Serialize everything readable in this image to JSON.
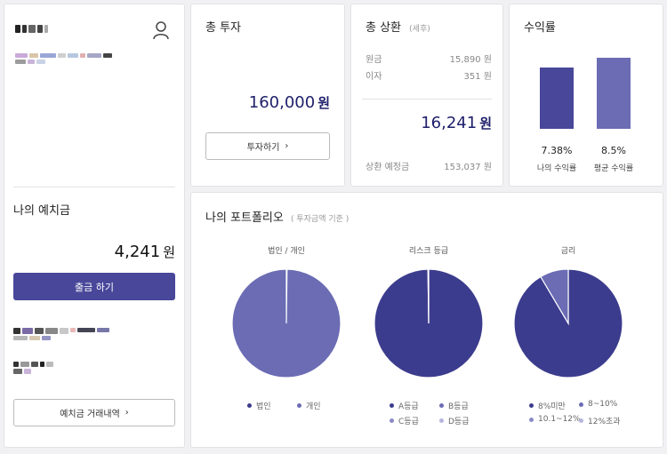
{
  "profile": {
    "user_icon": "user-icon"
  },
  "deposit": {
    "title": "나의 예치금",
    "amount": "4,241",
    "unit": "원",
    "withdraw_label": "출금 하기",
    "history_label": "예치금 거래내역"
  },
  "total_invest": {
    "title": "총 투자",
    "amount": "160,000",
    "unit": "원",
    "button_label": "투자하기"
  },
  "total_repay": {
    "title": "총 상환",
    "subtitle": "(세후)",
    "principal_label": "원금",
    "principal_value": "15,890 원",
    "interest_label": "이자",
    "interest_value": "351 원",
    "amount": "16,241",
    "unit": "원",
    "expected_label": "상환 예정금",
    "expected_value": "153,037 원"
  },
  "yield": {
    "title": "수익률",
    "colors": [
      "#48479a",
      "#6b6cb4"
    ]
  },
  "chart_data": [
    {
      "type": "bar",
      "categories": [
        "나의 수익률",
        "평균 수익률"
      ],
      "values": [
        7.38,
        8.5
      ],
      "value_labels": [
        "7.38%",
        "8.5%"
      ],
      "ylim": [
        0,
        8.5
      ]
    },
    {
      "type": "pie",
      "title": "법인 / 개인",
      "labels": [
        "법인",
        "개인"
      ],
      "values": [
        0.2,
        99.8
      ],
      "colors": [
        "#3c3c8e",
        "#6b6cb4"
      ]
    },
    {
      "type": "pie",
      "title": "리스크 등급",
      "labels": [
        "A등급",
        "B등급",
        "C등급",
        "D등급"
      ],
      "values": [
        99.8,
        0.2,
        0,
        0
      ],
      "colors": [
        "#3c3c8e",
        "#6b6cb4",
        "#8a8ac6",
        "#b6b6dc"
      ]
    },
    {
      "type": "pie",
      "title": "금리",
      "labels": [
        "8%미만",
        "8~10%",
        "10.1~12%",
        "12%초과"
      ],
      "values": [
        91.5,
        8.5,
        0,
        0
      ],
      "colors": [
        "#3c3c8e",
        "#6b6cb4",
        "#8a8ac6",
        "#b6b6dc"
      ]
    }
  ],
  "portfolio": {
    "title": "나의 포트폴리오",
    "subtitle": "( 투자금액 기준 )"
  }
}
